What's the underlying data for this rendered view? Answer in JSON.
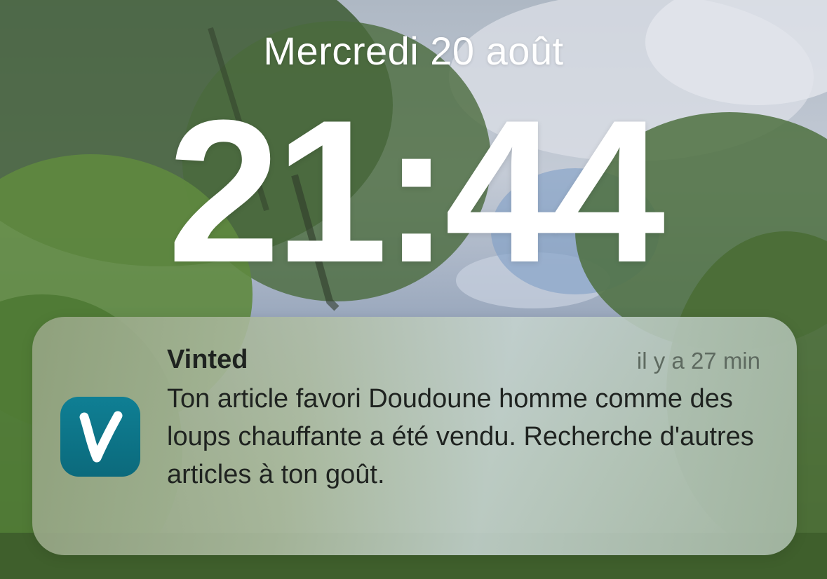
{
  "lockscreen": {
    "date": "Mercredi 20 août",
    "time": "21:44"
  },
  "notification": {
    "app_name": "Vinted",
    "timestamp": "il y a 27 min",
    "body": "Ton article favori Doudoune homme comme des loups chauffante a été vendu. Recherche d'autres articles à ton goût.",
    "icon": "vinted-app-icon",
    "icon_letter": "V",
    "icon_color": "#0d7488"
  }
}
